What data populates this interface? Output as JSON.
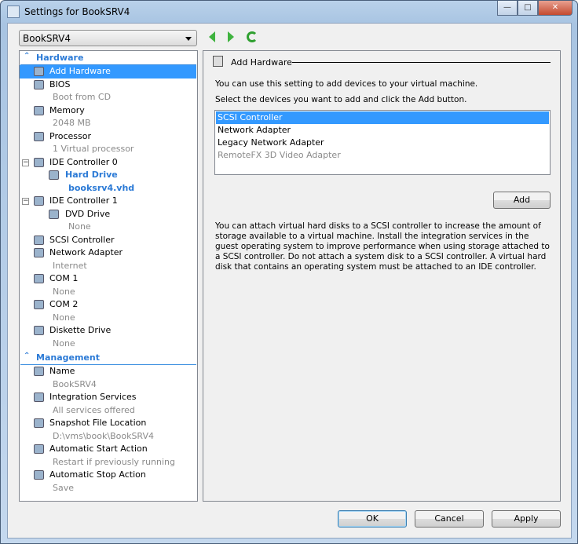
{
  "window": {
    "title": "Settings for BookSRV4",
    "min": "—",
    "max": "□",
    "close": "✕"
  },
  "vm_select": {
    "value": "BookSRV4"
  },
  "tree": {
    "hardware_label": "Hardware",
    "hardware": [
      {
        "label": "Add Hardware",
        "selected": true,
        "icon": "add-hardware-icon"
      },
      {
        "label": "BIOS",
        "sub": "Boot from CD",
        "icon": "bios-icon"
      },
      {
        "label": "Memory",
        "sub": "2048 MB",
        "icon": "memory-icon"
      },
      {
        "label": "Processor",
        "sub": "1 Virtual processor",
        "icon": "processor-icon"
      },
      {
        "label": "IDE Controller 0",
        "expand": "−",
        "icon": "ide-controller-icon"
      },
      {
        "label": "Hard Drive",
        "sub": "booksrv4.vhd",
        "child": true,
        "highlight": true,
        "icon": "hard-drive-icon"
      },
      {
        "label": "IDE Controller 1",
        "expand": "−",
        "icon": "ide-controller-icon"
      },
      {
        "label": "DVD Drive",
        "sub": "None",
        "child": true,
        "icon": "dvd-drive-icon"
      },
      {
        "label": "SCSI Controller",
        "icon": "scsi-controller-icon"
      },
      {
        "label": "Network Adapter",
        "sub": "Internet",
        "icon": "network-adapter-icon"
      },
      {
        "label": "COM 1",
        "sub": "None",
        "icon": "com-port-icon"
      },
      {
        "label": "COM 2",
        "sub": "None",
        "icon": "com-port-icon"
      },
      {
        "label": "Diskette Drive",
        "sub": "None",
        "icon": "diskette-icon"
      }
    ],
    "management_label": "Management",
    "management": [
      {
        "label": "Name",
        "sub": "BookSRV4",
        "icon": "name-icon"
      },
      {
        "label": "Integration Services",
        "sub": "All services offered",
        "icon": "integration-services-icon"
      },
      {
        "label": "Snapshot File Location",
        "sub": "D:\\vms\\book\\BookSRV4",
        "icon": "snapshot-folder-icon"
      },
      {
        "label": "Automatic Start Action",
        "sub": "Restart if previously running",
        "icon": "start-action-icon"
      },
      {
        "label": "Automatic Stop Action",
        "sub": "Save",
        "icon": "stop-action-icon"
      }
    ]
  },
  "panel": {
    "title": "Add Hardware",
    "intro": "You can use this setting to add devices to your virtual machine.",
    "instruction": "Select the devices you want to add and click the Add button.",
    "devices": [
      {
        "label": "SCSI Controller",
        "selected": true
      },
      {
        "label": "Network Adapter"
      },
      {
        "label": "Legacy Network Adapter"
      },
      {
        "label": "RemoteFX 3D Video Adapter",
        "disabled": true
      }
    ],
    "add_label": "Add",
    "description": "You can attach virtual hard disks to a SCSI controller to increase the amount of storage available to a virtual machine. Install the integration services in the guest operating system to improve performance when using storage attached to a SCSI controller. Do not attach a system disk to a SCSI controller. A virtual hard disk that contains an operating system must be attached to an IDE controller."
  },
  "buttons": {
    "ok": "OK",
    "cancel": "Cancel",
    "apply": "Apply"
  },
  "colors": {
    "selection": "#3399ff",
    "section_header": "#2b7ad6",
    "nav_arrow": "#3fb33f"
  }
}
